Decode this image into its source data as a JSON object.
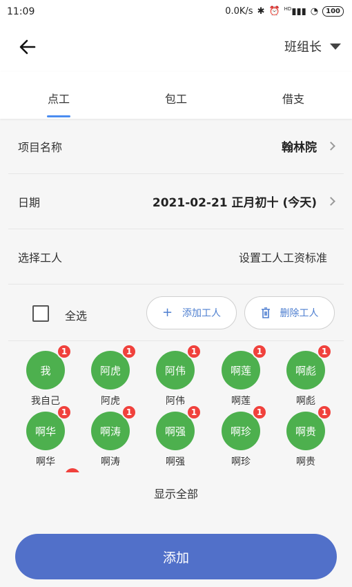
{
  "status": {
    "time": "11:09",
    "speed": "0.0K/s",
    "battery": "100",
    "signal_hd": "HD"
  },
  "header": {
    "role": "班组长"
  },
  "tabs": [
    {
      "label": "点工"
    },
    {
      "label": "包工"
    },
    {
      "label": "借支"
    }
  ],
  "form": {
    "project_label": "项目名称",
    "project_value": "翰林院",
    "date_label": "日期",
    "date_value": "2021-02-21 正月初十 (今天)",
    "workers_label": "选择工人",
    "workers_link": "设置工人工资标准"
  },
  "actions": {
    "select_all": "全选",
    "add_worker": "添加工人",
    "delete_worker": "删除工人"
  },
  "workers": [
    {
      "avatar": "我",
      "name": "我自己",
      "badge": "1"
    },
    {
      "avatar": "阿虎",
      "name": "阿虎",
      "badge": "1"
    },
    {
      "avatar": "阿伟",
      "name": "阿伟",
      "badge": "1"
    },
    {
      "avatar": "啊莲",
      "name": "啊莲",
      "badge": "1"
    },
    {
      "avatar": "啊彪",
      "name": "啊彪",
      "badge": "1"
    },
    {
      "avatar": "啊华",
      "name": "啊华",
      "badge": "1"
    },
    {
      "avatar": "啊涛",
      "name": "啊涛",
      "badge": "1"
    },
    {
      "avatar": "啊强",
      "name": "啊强",
      "badge": "1"
    },
    {
      "avatar": "啊珍",
      "name": "啊珍",
      "badge": "1"
    },
    {
      "avatar": "啊贵",
      "name": "啊贵",
      "badge": "1"
    }
  ],
  "show_all": "显示全部",
  "submit": "添加",
  "colors": {
    "accent": "#5170c9",
    "avatar": "#4db04e",
    "badge": "#f0413c",
    "tab_indicator": "#4a8cf0"
  }
}
